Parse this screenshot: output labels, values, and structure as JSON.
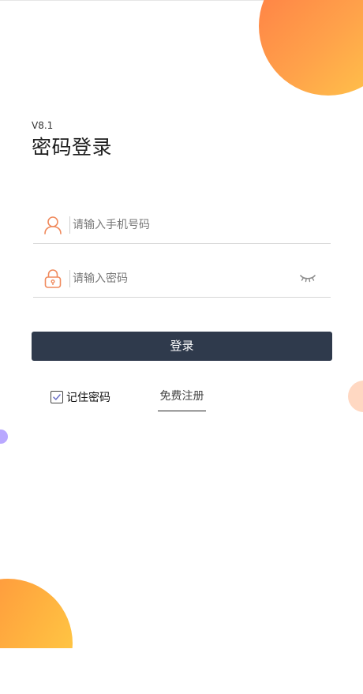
{
  "version": "V8.1",
  "title": "密码登录",
  "phone_field": {
    "placeholder": "请输入手机号码",
    "value": "",
    "icon": "user-icon"
  },
  "password_field": {
    "placeholder": "请输入密码",
    "value": "",
    "icon": "lock-icon",
    "toggle_icon": "eye-closed-icon"
  },
  "login_button": {
    "label": "登录"
  },
  "remember": {
    "label": "记住密码",
    "checked": true
  },
  "register_link": {
    "label": "免费注册"
  },
  "colors": {
    "primary_button": "#2f3a4c",
    "accent_orange": "#ff8a3d",
    "icon_orange": "#f08a5d"
  }
}
